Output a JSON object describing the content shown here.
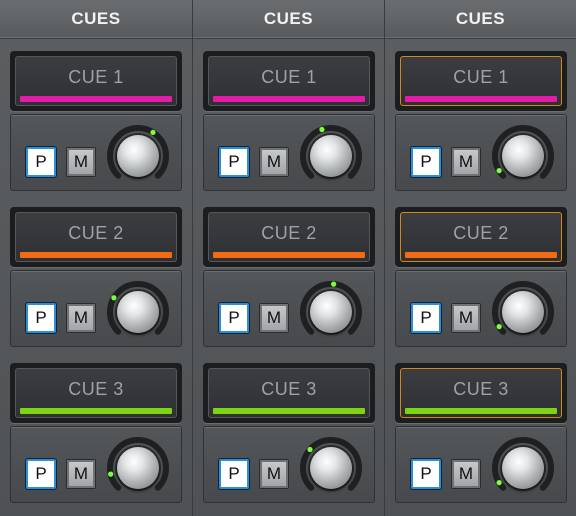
{
  "columns": [
    {
      "header": "CUES",
      "cues": [
        {
          "label": "CUE 1",
          "stripe_color": "#e21ba8",
          "selected": false,
          "p": "P",
          "m": "M",
          "knob_level": 0.62
        },
        {
          "label": "CUE 2",
          "stripe_color": "#f26a13",
          "selected": false,
          "p": "P",
          "m": "M",
          "knob_level": 0.28
        },
        {
          "label": "CUE 3",
          "stripe_color": "#7cd414",
          "selected": false,
          "p": "P",
          "m": "M",
          "knob_level": 0.12
        }
      ]
    },
    {
      "header": "CUES",
      "cues": [
        {
          "label": "CUE 1",
          "stripe_color": "#e21ba8",
          "selected": false,
          "p": "P",
          "m": "M",
          "knob_level": 0.43
        },
        {
          "label": "CUE 2",
          "stripe_color": "#f26a13",
          "selected": false,
          "p": "P",
          "m": "M",
          "knob_level": 0.52
        },
        {
          "label": "CUE 3",
          "stripe_color": "#7cd414",
          "selected": false,
          "p": "P",
          "m": "M",
          "knob_level": 0.32
        }
      ]
    },
    {
      "header": "CUES",
      "cues": [
        {
          "label": "CUE 1",
          "stripe_color": "#e21ba8",
          "selected": true,
          "p": "P",
          "m": "M",
          "knob_level": 0.05
        },
        {
          "label": "CUE 2",
          "stripe_color": "#f26a13",
          "selected": true,
          "p": "P",
          "m": "M",
          "knob_level": 0.05
        },
        {
          "label": "CUE 3",
          "stripe_color": "#7cd414",
          "selected": true,
          "p": "P",
          "m": "M",
          "knob_level": 0.05
        }
      ]
    }
  ],
  "colors": {
    "selected_outline": "#d4861a",
    "p_button_border": "#2c8fd9",
    "knob_indicator": "#7cff3a"
  }
}
